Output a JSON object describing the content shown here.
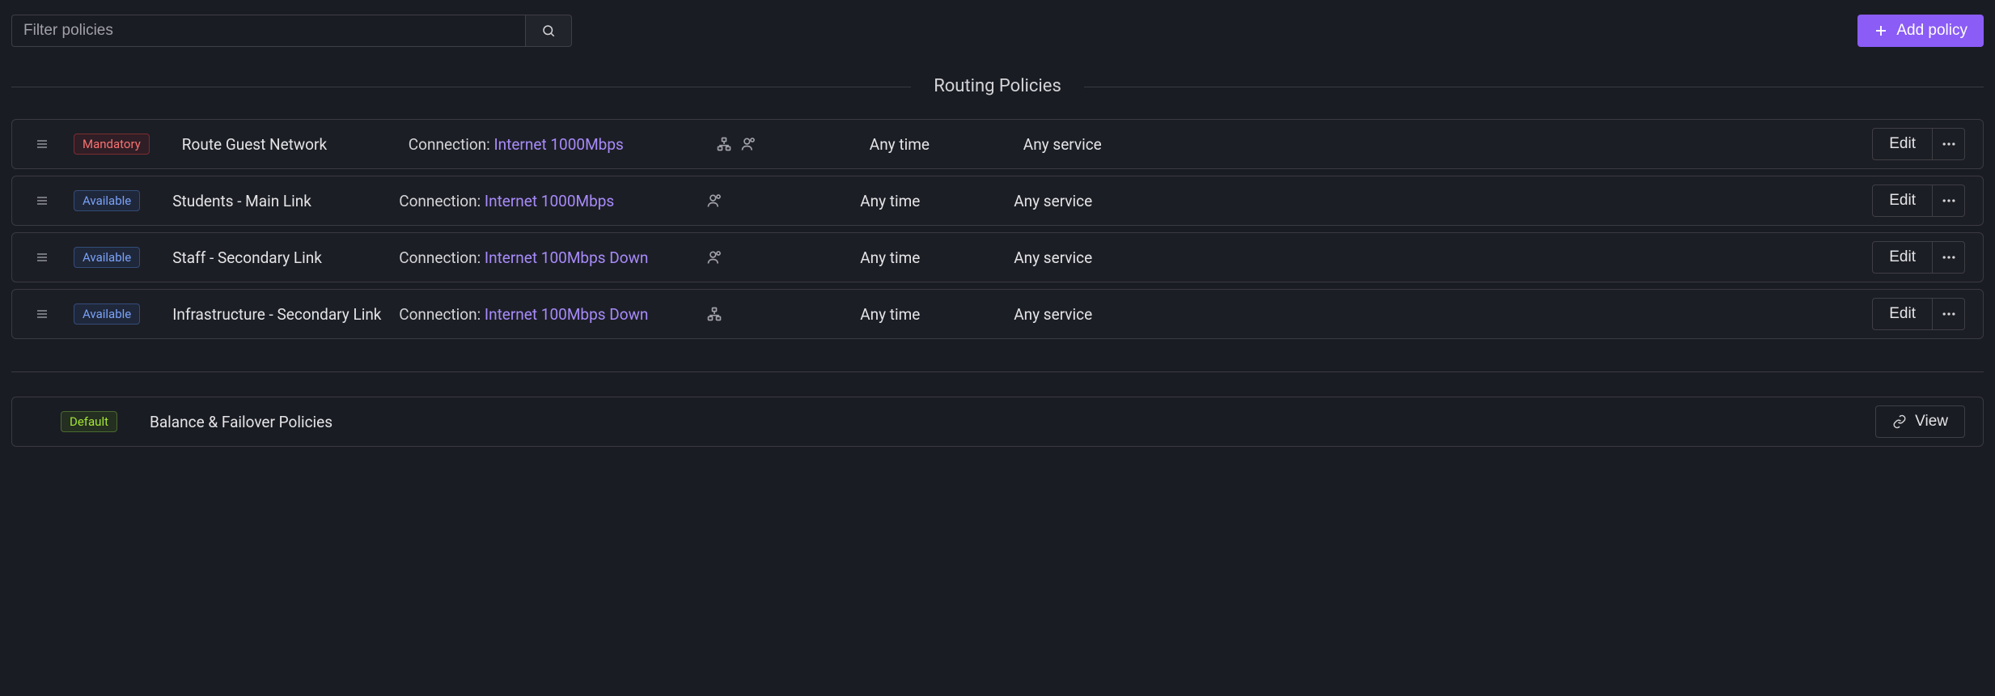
{
  "toolbar": {
    "filter_placeholder": "Filter policies",
    "add_label": "Add policy"
  },
  "section_title": "Routing Policies",
  "badge_labels": {
    "mandatory": "Mandatory",
    "available": "Available",
    "default": "Default"
  },
  "connection_label": "Connection: ",
  "edit_label": "Edit",
  "view_label": "View",
  "policies": [
    {
      "badge": "mandatory",
      "name": "Route Guest Network",
      "connection": "Internet 1000Mbps",
      "show_network_icon": true,
      "show_user_icon": true,
      "time": "Any time",
      "service": "Any service"
    },
    {
      "badge": "available",
      "name": "Students - Main Link",
      "connection": "Internet 1000Mbps",
      "show_network_icon": false,
      "show_user_icon": true,
      "time": "Any time",
      "service": "Any service"
    },
    {
      "badge": "available",
      "name": "Staff - Secondary Link",
      "connection": "Internet 100Mbps Down",
      "show_network_icon": false,
      "show_user_icon": true,
      "time": "Any time",
      "service": "Any service"
    },
    {
      "badge": "available",
      "name": "Infrastructure - Secondary Link",
      "connection": "Internet 100Mbps Down",
      "show_network_icon": true,
      "show_user_icon": false,
      "time": "Any time",
      "service": "Any service"
    }
  ],
  "failover": {
    "name": "Balance & Failover Policies"
  }
}
